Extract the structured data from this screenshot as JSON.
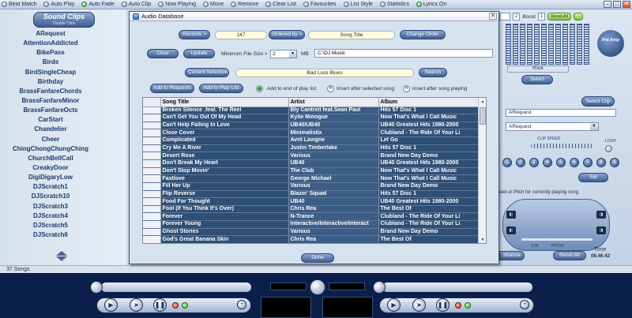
{
  "toolbar": {
    "items": [
      {
        "label": "Beat Match",
        "on": false
      },
      {
        "label": "Auto Play",
        "on": false
      },
      {
        "label": "Auto Fade",
        "on": true
      },
      {
        "label": "Auto Clip",
        "on": false
      },
      {
        "label": "Now Playing",
        "on": false
      },
      {
        "label": "Move",
        "on": false
      },
      {
        "label": "Remove",
        "on": false
      },
      {
        "label": "Clear List",
        "on": false
      },
      {
        "label": "Favourites",
        "on": false
      },
      {
        "label": "List Style",
        "on": false
      },
      {
        "label": "Statistics",
        "on": false
      },
      {
        "label": "Lyrics On",
        "on": true
      }
    ]
  },
  "left_panel": {
    "header_title": "Sound Clips",
    "header_subtitle": "Double Click",
    "clips": [
      "ARequest",
      "AttentionAddicted",
      "BikePass",
      "Birds",
      "BirdSingleCheap",
      "Birthday",
      "BrassFanfareChords",
      "BrassFanfareMinor",
      "BrassFanfareOcts",
      "CarStart",
      "Chandelier",
      "Cheer",
      "ChingChongChungChing",
      "ChurchBellCall",
      "CreakyDoor",
      "DigiDigaryLow",
      "DJScratch1",
      "DJScratch10",
      "DJScratch3",
      "DJScratch4",
      "DJScratch5",
      "DJScratch6"
    ]
  },
  "right_panel": {
    "boost_label": "Boost",
    "boost_value": "1",
    "reset_label": "Reset All",
    "preamp_label": "Pre Amp",
    "preset_name": "Rock",
    "select_label": "Select",
    "select_clip_label": "Select Clip",
    "request_label": "ARequest",
    "request_select": "ARequest",
    "clip_speed_label": "CLIP SPEED",
    "loop_label": "LOOP",
    "numbers": [
      "1",
      "2",
      "3",
      "4",
      "5",
      "6",
      "7",
      "8",
      "9"
    ],
    "set_label": "Set",
    "speed_note": "Speed or Pitch for currently playing song",
    "pitch_zero": "0.00",
    "pitch_label": "PITCH",
    "enhance_label": "nhance",
    "reset_all_label": "Reset All",
    "time_label": "Time",
    "time_value": "08:46:42"
  },
  "status": {
    "song_count": "37 Songs"
  },
  "dialog": {
    "title": "Audio Database",
    "records_label": "Records >",
    "records_value": "147",
    "ordered_by_label": "Ordered by >",
    "ordered_by_value": "Song Title",
    "change_order_label": "Change Order",
    "clear_label": "Clear",
    "update_label": "Update",
    "min_size_label": "Minimum File Size >",
    "min_size_value": "2",
    "mb_label": "MB",
    "path_value": "C:\\DJ Music",
    "current_selection_label": "Current Selection",
    "current_selection_value": "Bad Luck Blues",
    "search_label": "Search",
    "add_requests_label": "Add to Requests",
    "add_playlist_label": "Add to Play List",
    "radio_end_label": "Add to end of play list",
    "radio_after_selected_label": "Insert after selected song",
    "radio_after_playing_label": "Insert after song playing",
    "done_label": "Done",
    "columns": [
      "Song Title",
      "Artist",
      "Album"
    ],
    "rows": [
      [
        "Broken Silence .feat. The Reel",
        "Bly Cantrell feat.Sean Paul",
        "Hits 57  Disc 1"
      ],
      [
        "Can't Get You Out Of My Head",
        "Kylie Minogue",
        "Now That's What I Call Music"
      ],
      [
        "Can't Help Falling In Love",
        "UB40/UB40",
        "UB40 Greatest Hits 1980-2000"
      ],
      [
        "Close Cover",
        "Minimalistix",
        "Clubland - The Ride Of Your Li"
      ],
      [
        "Complicated",
        "Avril Lavigne",
        "Let Go"
      ],
      [
        "Cry Me A River",
        "Justin Timberlake",
        "Hits 57  Disc 1"
      ],
      [
        "Desert Rose",
        "Various",
        "Brand New Day Demo"
      ],
      [
        "Don't Break My Heart",
        "UB40",
        "UB40 Greatest Hits 1980-2000"
      ],
      [
        "Don't Stop Movin'",
        "The Club",
        "Now That's What I Call Music"
      ],
      [
        "Fastlove",
        "George Michael",
        "Now That's What I Call Music"
      ],
      [
        "Fill Her Up",
        "Various",
        "Brand New Day Demo"
      ],
      [
        "Flip Reverse",
        "Blazin' Squad",
        "Hits 57  Disc 1"
      ],
      [
        "Food For Thought",
        "UB40",
        "UB40 Greatest Hits 1980-2000"
      ],
      [
        "Fool (If You Think It's Over)",
        "Chris Rea",
        "The Best Of"
      ],
      [
        "Forever",
        "N-Trance",
        "Clubland - The Ride Of Your Li"
      ],
      [
        "Forever Young",
        "Interactive/Interactive/Interact",
        "Clubland - The Ride Of Your Li"
      ],
      [
        "Ghost Stories",
        "Various",
        "Brand New Day Demo"
      ],
      [
        "God's Great Banana Skin",
        "Chris Rea",
        "The Best Of"
      ]
    ]
  },
  "colors": {
    "row_bg": "#2f4f75",
    "accent": "#3e5f93",
    "deck_bg": "#0b1f4b"
  }
}
